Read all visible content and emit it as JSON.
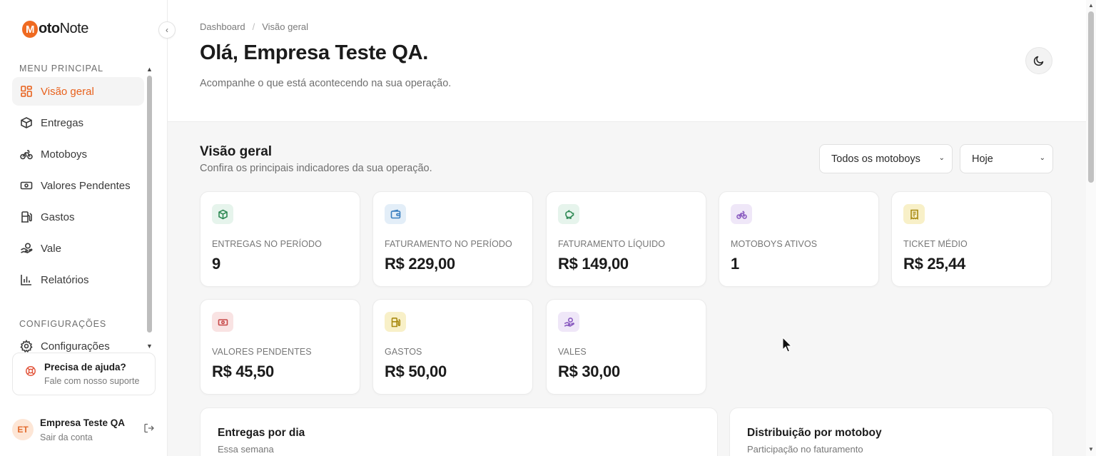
{
  "app": {
    "logo_letter": "M",
    "logo_bold": "oto",
    "logo_light": "Note"
  },
  "sidebar": {
    "menu_label": "MENU PRINCIPAL",
    "items": [
      {
        "label": "Visão geral",
        "icon": "grid-icon"
      },
      {
        "label": "Entregas",
        "icon": "package-icon"
      },
      {
        "label": "Motoboys",
        "icon": "bike-icon"
      },
      {
        "label": "Valores Pendentes",
        "icon": "cash-icon"
      },
      {
        "label": "Gastos",
        "icon": "fuel-icon"
      },
      {
        "label": "Vale",
        "icon": "hand-coin-icon"
      },
      {
        "label": "Relatórios",
        "icon": "bar-chart-icon"
      }
    ],
    "config_label": "CONFIGURAÇÕES",
    "config_item": "Configurações",
    "help_title": "Precisa de ajuda?",
    "help_sub": "Fale com nosso suporte",
    "user_initials": "ET",
    "user_name": "Empresa Teste QA",
    "user_sub": "Sair da conta"
  },
  "header": {
    "breadcrumb": [
      "Dashboard",
      "Visão geral"
    ],
    "title": "Olá, Empresa Teste QA.",
    "subtitle": "Acompanhe o que está acontecendo na sua operação."
  },
  "overview": {
    "title": "Visão geral",
    "subtitle": "Confira os principais indicadores da sua operação.",
    "filter_motoboy": "Todos os motoboys",
    "filter_period": "Hoje"
  },
  "cards": [
    {
      "label": "ENTREGAS NO PERÍODO",
      "value": "9",
      "icon": "package-icon",
      "color": "#2f8a55",
      "bg": "#e6f4ec"
    },
    {
      "label": "FATURAMENTO NO PERÍODO",
      "value": "R$ 229,00",
      "icon": "wallet-icon",
      "color": "#3b7fbf",
      "bg": "#e3eef8"
    },
    {
      "label": "FATURAMENTO LÍQUIDO",
      "value": "R$ 149,00",
      "icon": "piggy-bank-icon",
      "color": "#2f8a55",
      "bg": "#e6f4ec"
    },
    {
      "label": "MOTOBOYS ATIVOS",
      "value": "1",
      "icon": "bike-icon",
      "color": "#8a5bc0",
      "bg": "#efe7f8"
    },
    {
      "label": "TICKET MÉDIO",
      "value": "R$ 25,44",
      "icon": "receipt-icon",
      "color": "#a88a12",
      "bg": "#f8f0c8"
    },
    {
      "label": "VALORES PENDENTES",
      "value": "R$ 45,50",
      "icon": "cash-icon",
      "color": "#c74a4a",
      "bg": "#f9e3e3"
    },
    {
      "label": "GASTOS",
      "value": "R$ 50,00",
      "icon": "fuel-icon",
      "color": "#a88a12",
      "bg": "#f8f0c8"
    },
    {
      "label": "VALES",
      "value": "R$ 30,00",
      "icon": "hand-coin-icon",
      "color": "#8a5bc0",
      "bg": "#efe7f8"
    }
  ],
  "panels": [
    {
      "title": "Entregas por dia",
      "subtitle": "Essa semana"
    },
    {
      "title": "Distribuição por motoboy",
      "subtitle": "Participação no faturamento"
    }
  ]
}
